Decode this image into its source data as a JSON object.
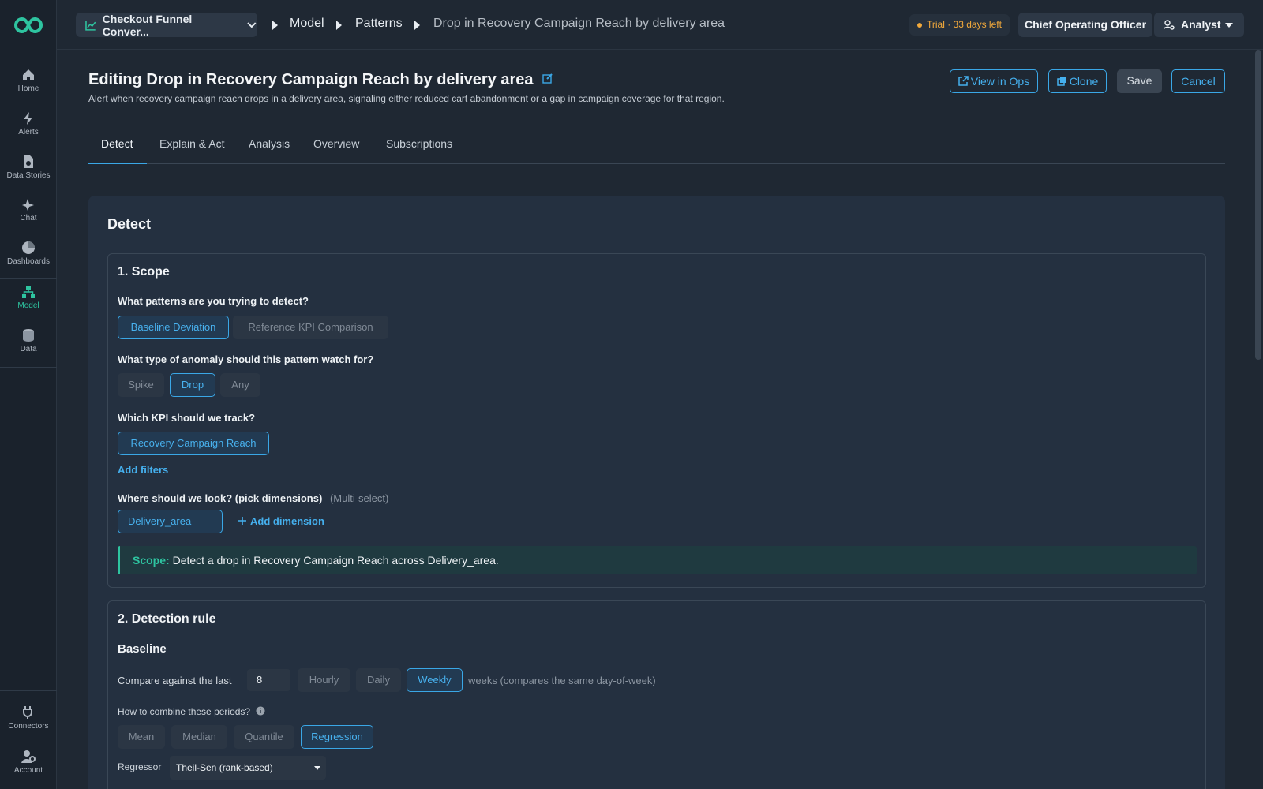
{
  "sidebar": {
    "items": [
      {
        "label": "Home",
        "icon": "home-icon"
      },
      {
        "label": "Alerts",
        "icon": "bolt-icon"
      },
      {
        "label": "Data Stories",
        "icon": "document-icon"
      },
      {
        "label": "Chat",
        "icon": "sparkle-icon"
      },
      {
        "label": "Dashboards",
        "icon": "pie-chart-icon"
      },
      {
        "label": "Model",
        "icon": "hierarchy-icon",
        "active": true
      },
      {
        "label": "Data",
        "icon": "database-icon"
      }
    ],
    "bottom": [
      {
        "label": "Connectors",
        "icon": "plug-icon"
      },
      {
        "label": "Account",
        "icon": "user-gear-icon"
      }
    ]
  },
  "topbar": {
    "dataset": "Checkout Funnel Conver...",
    "breadcrumbs": [
      "Model",
      "Patterns",
      "Drop in Recovery Campaign Reach by delivery area"
    ],
    "trial": "Trial · 33 days left",
    "role": "Chief Operating Officer",
    "user_role": "Analyst"
  },
  "header": {
    "title": "Editing Drop in Recovery Campaign Reach by delivery area",
    "subtitle": "Alert when recovery campaign reach drops in a delivery area, signaling either reduced cart abandonment or a gap in campaign coverage for that region.",
    "buttons": {
      "view": "View in Ops",
      "clone": "Clone",
      "save": "Save",
      "cancel": "Cancel"
    }
  },
  "tabs": [
    "Detect",
    "Explain & Act",
    "Analysis",
    "Overview",
    "Subscriptions"
  ],
  "detect": {
    "title": "Detect",
    "scope": {
      "title": "1. Scope",
      "q_patterns": "What patterns are you trying to detect?",
      "patterns": [
        "Baseline Deviation",
        "Reference KPI Comparison"
      ],
      "q_anomaly": "What type of anomaly should this pattern watch for?",
      "anomaly": [
        "Spike",
        "Drop",
        "Any"
      ],
      "q_kpi": "Which KPI should we track?",
      "kpi": "Recovery Campaign Reach",
      "add_filters": "Add filters",
      "q_dimensions": "Where should we look? (pick dimensions)",
      "multi": "(Multi-select)",
      "dimension": "Delivery_area",
      "add_dimension": "Add dimension",
      "summary_key": "Scope:",
      "summary": "Detect a drop in Recovery Campaign Reach across Delivery_area."
    },
    "rule": {
      "title": "2. Detection rule",
      "baseline": "Baseline",
      "compare_label": "Compare against the last",
      "periods": "8",
      "granularity": [
        "Hourly",
        "Daily",
        "Weekly"
      ],
      "granularity_note": "weeks (compares the same day-of-week)",
      "combine_label": "How to combine these periods?",
      "combine": [
        "Mean",
        "Median",
        "Quantile",
        "Regression"
      ],
      "regressor_label": "Regressor",
      "regressor": "Theil-Sen (rank-based)"
    }
  },
  "colors": {
    "accent": "#3aa7e6",
    "brand": "#2ec4a0",
    "warning": "#f2a93b"
  }
}
